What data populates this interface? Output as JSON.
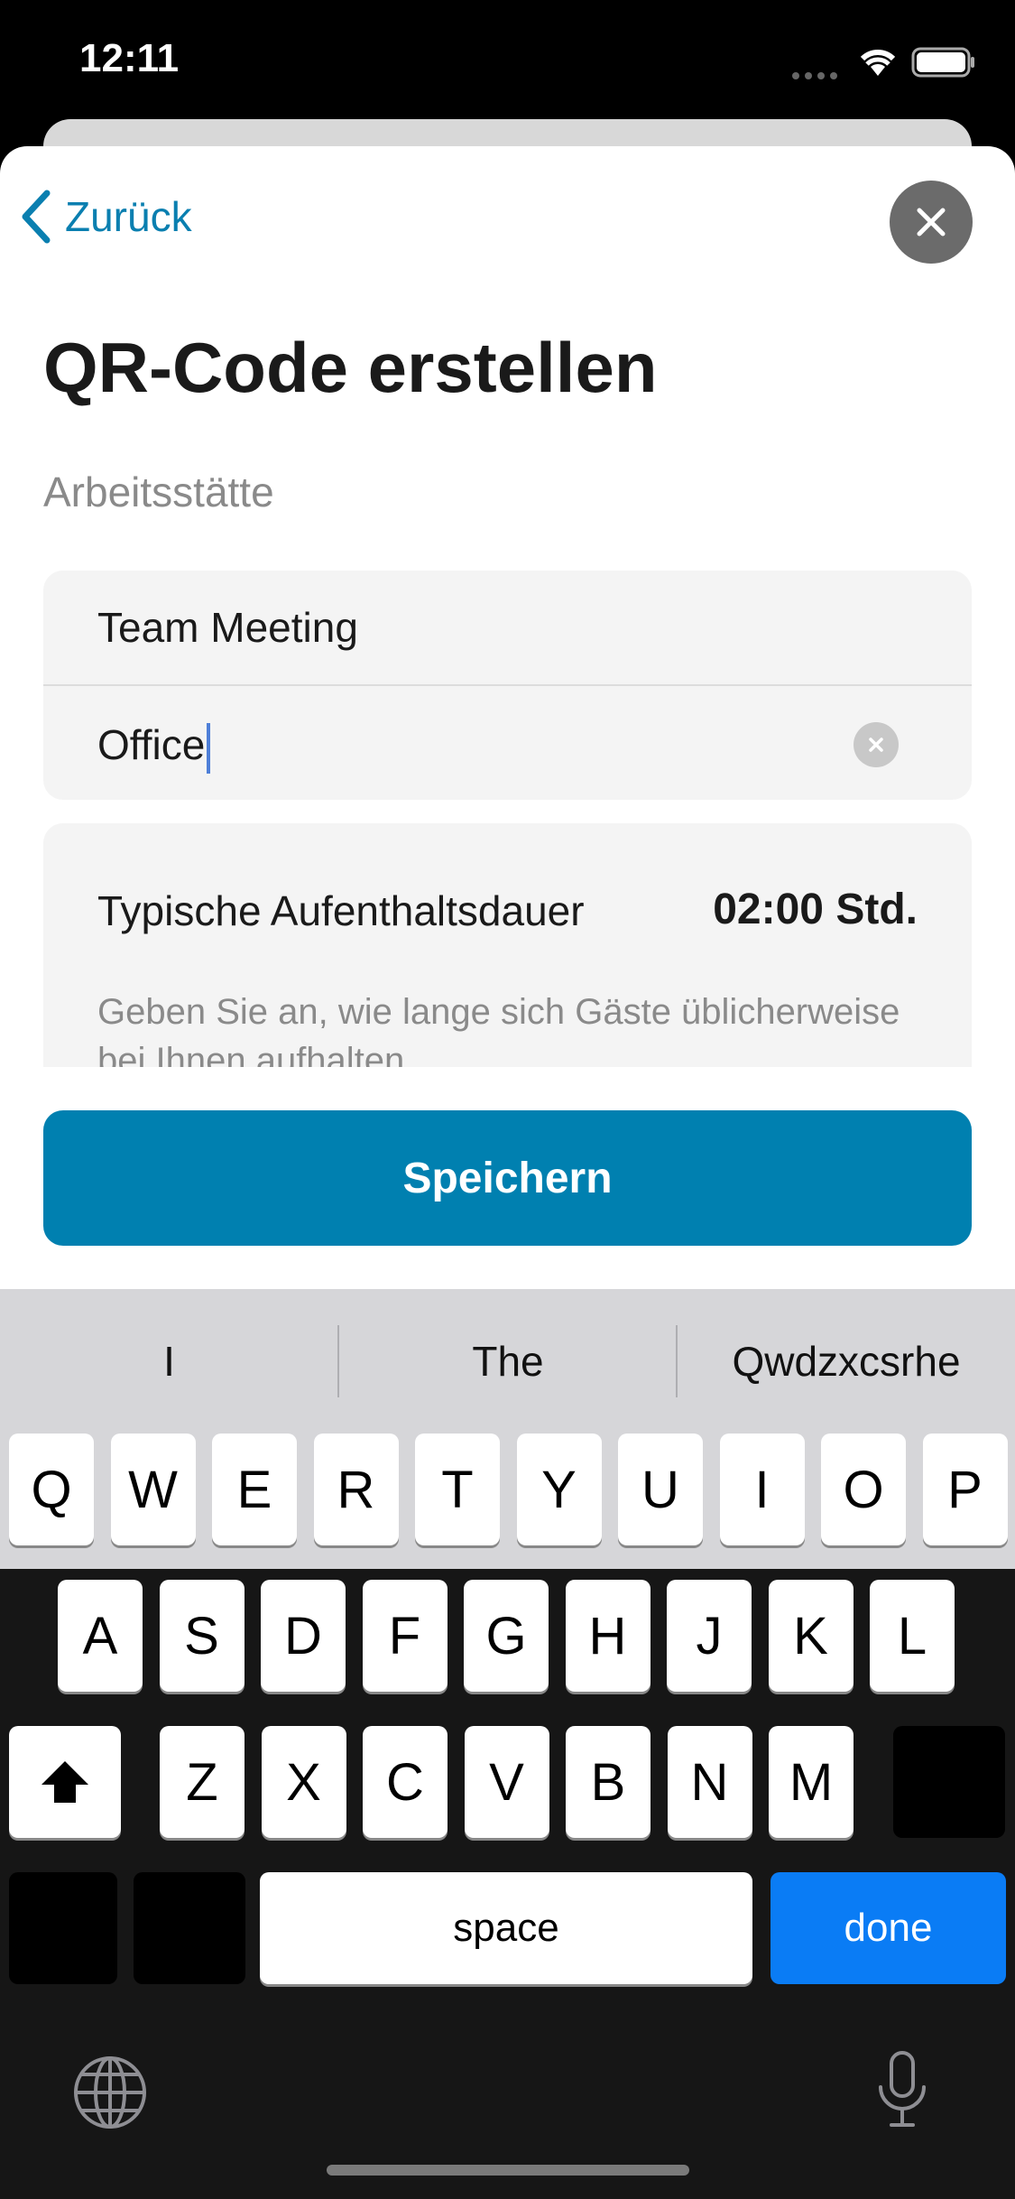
{
  "status_bar": {
    "time": "12:11"
  },
  "nav": {
    "back_label": "Zurück"
  },
  "page": {
    "title": "QR-Code erstellen",
    "section_label": "Arbeitsstätte"
  },
  "form": {
    "field1_value": "Team Meeting",
    "field2_value": "Office",
    "duration_label": "Typische Aufenthaltsdauer",
    "duration_value": "02:00 Std.",
    "hint": "Geben Sie an, wie lange sich Gäste üblicherweise bei Ihnen aufhalten"
  },
  "actions": {
    "save_label": "Speichern"
  },
  "keyboard": {
    "suggestions": [
      "I",
      "The",
      "Qwdzxcsrhe"
    ],
    "row1": [
      "Q",
      "W",
      "E",
      "R",
      "T",
      "Y",
      "U",
      "I",
      "O",
      "P"
    ],
    "row2": [
      "A",
      "S",
      "D",
      "F",
      "G",
      "H",
      "J",
      "K",
      "L"
    ],
    "row3": [
      "Z",
      "X",
      "C",
      "V",
      "B",
      "N",
      "M"
    ],
    "space_label": "space",
    "done_label": "done"
  },
  "colors": {
    "accent": "#0080B0",
    "done_key": "#0A7CF5"
  }
}
